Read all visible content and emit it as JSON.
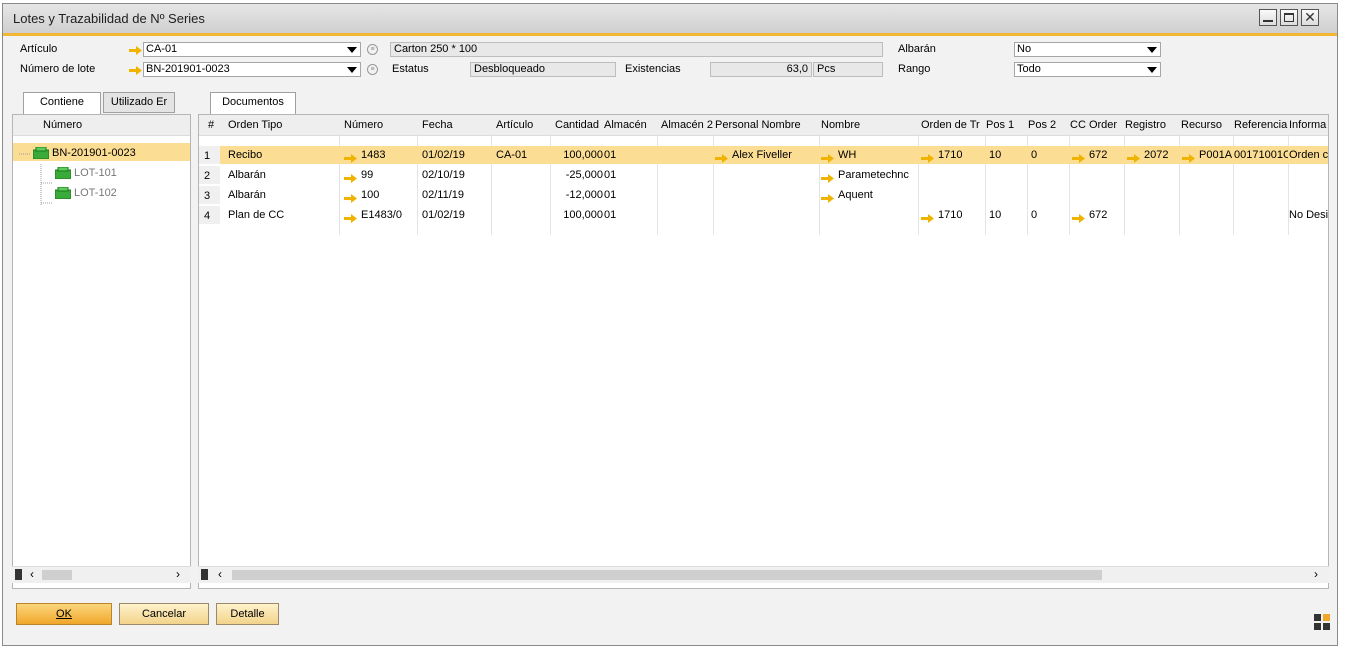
{
  "window": {
    "title": "Lotes y Trazabilidad de Nº Series"
  },
  "form": {
    "articulo_label": "Artículo",
    "articulo_value": "CA-01",
    "articulo_desc": "Carton 250 * 100",
    "lote_label": "Número de lote",
    "lote_value": "BN-201901-0023",
    "estatus_label": "Estatus",
    "estatus_value": "Desbloqueado",
    "existencias_label": "Existencias",
    "existencias_value": "63,0",
    "existencias_unit": "Pcs",
    "albaran_label": "Albarán",
    "albaran_value": "No",
    "rango_label": "Rango",
    "rango_value": "Todo"
  },
  "left_tabs": [
    "Contiene",
    "Utilizado Er"
  ],
  "tree": {
    "header": "Número",
    "root": "BN-201901-0023",
    "children": [
      "LOT-101",
      "LOT-102"
    ]
  },
  "right_tab": "Documentos",
  "grid": {
    "headers": [
      "#",
      "Orden Tipo",
      "Número",
      "Fecha",
      "Artículo",
      "Cantidad",
      "Almacén",
      "Almacén 2",
      "Personal Nombre",
      "Nombre",
      "Orden de Tr",
      "Pos 1",
      "Pos 2",
      "CC Order",
      "Registro",
      "Recurso",
      "Referencia",
      "Informa"
    ],
    "rows": [
      {
        "num": "1",
        "tipo": "Recibo",
        "numero": "1483",
        "fecha": "01/02/19",
        "articulo": "CA-01",
        "cantidad": "100,000",
        "almacen": "01",
        "almacen2": "",
        "personal": "Alex Fiveller",
        "nombre": "WH",
        "orden": "1710",
        "pos1": "10",
        "pos2": "0",
        "cc": "672",
        "registro": "2072",
        "recurso": "P001A",
        "referencia": "00171001C",
        "informa": "Orden c"
      },
      {
        "num": "2",
        "tipo": "Albarán",
        "numero": "99",
        "fecha": "02/10/19",
        "articulo": "",
        "cantidad": "-25,000",
        "almacen": "01",
        "almacen2": "",
        "personal": "",
        "nombre": "Parametechnc",
        "orden": "",
        "pos1": "",
        "pos2": "",
        "cc": "",
        "registro": "",
        "recurso": "",
        "referencia": "",
        "informa": ""
      },
      {
        "num": "3",
        "tipo": "Albarán",
        "numero": "100",
        "fecha": "02/11/19",
        "articulo": "",
        "cantidad": "-12,000",
        "almacen": "01",
        "almacen2": "",
        "personal": "",
        "nombre": "Aquent",
        "orden": "",
        "pos1": "",
        "pos2": "",
        "cc": "",
        "registro": "",
        "recurso": "",
        "referencia": "",
        "informa": ""
      },
      {
        "num": "4",
        "tipo": "Plan de CC",
        "numero": "E1483/0",
        "fecha": "01/02/19",
        "articulo": "",
        "cantidad": "100,000",
        "almacen": "01",
        "almacen2": "",
        "personal": "",
        "nombre": "",
        "orden": "1710",
        "pos1": "10",
        "pos2": "0",
        "cc": "672",
        "registro": "",
        "recurso": "",
        "referencia": "",
        "informa": "No Desi"
      }
    ]
  },
  "buttons": {
    "ok": "OK",
    "cancel": "Cancelar",
    "detail": "Detalle"
  },
  "colors": {
    "accent": "#f2b632",
    "selection": "#fbdd94",
    "link_arrow": "#f0b400"
  }
}
